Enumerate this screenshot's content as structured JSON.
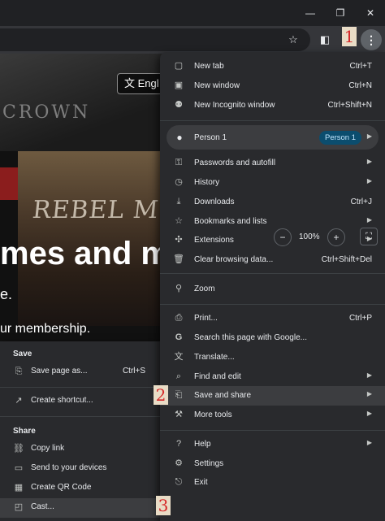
{
  "window_controls": {
    "minimize_icon": "—",
    "maximize_icon": "❐",
    "close_icon": "✕"
  },
  "toolbar": {
    "bookmark_icon": "☆",
    "sidepanel_icon": "◧",
    "menu_icon": "⋮"
  },
  "markers": [
    "1",
    "2",
    "3"
  ],
  "page": {
    "lang_button": "Engl",
    "hero_title": "mes and m",
    "hero_sub": "e.",
    "hero_sub2": "ur membership.",
    "art_text1": "CROWN",
    "art_text2": "REBEL MOON"
  },
  "menu": {
    "new_tab": {
      "label": "New tab",
      "shortcut": "Ctrl+T"
    },
    "new_window": {
      "label": "New window",
      "shortcut": "Ctrl+N"
    },
    "new_incognito": {
      "label": "New Incognito window",
      "shortcut": "Ctrl+Shift+N"
    },
    "profile": {
      "label": "Person 1",
      "chip": "Person 1"
    },
    "passwords": {
      "label": "Passwords and autofill"
    },
    "history": {
      "label": "History"
    },
    "downloads": {
      "label": "Downloads",
      "shortcut": "Ctrl+J"
    },
    "bookmarks": {
      "label": "Bookmarks and lists"
    },
    "extensions": {
      "label": "Extensions"
    },
    "clear_data": {
      "label": "Clear browsing data...",
      "shortcut": "Ctrl+Shift+Del"
    },
    "zoom": {
      "label": "Zoom",
      "minus": "−",
      "value": "100%",
      "plus": "+",
      "fullscreen": "⛶"
    },
    "print": {
      "label": "Print...",
      "shortcut": "Ctrl+P"
    },
    "search_google": {
      "label": "Search this page with Google..."
    },
    "translate": {
      "label": "Translate..."
    },
    "find_edit": {
      "label": "Find and edit"
    },
    "save_share": {
      "label": "Save and share"
    },
    "more_tools": {
      "label": "More tools"
    },
    "help": {
      "label": "Help"
    },
    "settings": {
      "label": "Settings"
    },
    "exit": {
      "label": "Exit"
    }
  },
  "submenu": {
    "save_heading": "Save",
    "save_page": {
      "label": "Save page as...",
      "shortcut": "Ctrl+S"
    },
    "create_shortcut": {
      "label": "Create shortcut..."
    },
    "share_heading": "Share",
    "copy_link": {
      "label": "Copy link"
    },
    "send_devices": {
      "label": "Send to your devices"
    },
    "qr_code": {
      "label": "Create QR Code"
    },
    "cast": {
      "label": "Cast..."
    }
  }
}
